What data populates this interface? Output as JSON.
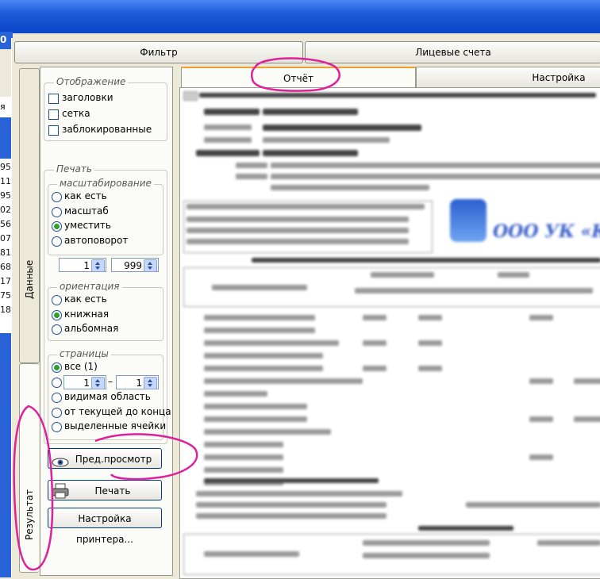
{
  "top_tabs": {
    "filter": "Фильтр",
    "accounts": "Лицевые счета"
  },
  "left_tabs": {
    "data": "Данные",
    "result": "Результат"
  },
  "display": {
    "title": "Отображение",
    "items": [
      "заголовки",
      "сетка",
      "заблокированные"
    ]
  },
  "print": {
    "title": "Печать",
    "scaling": {
      "title": "масштабирование",
      "options": [
        "как есть",
        "масштаб",
        "уместить",
        "автоповорот"
      ],
      "selected": "уместить",
      "spin_pages": "1",
      "spin_percent": "999"
    },
    "orientation": {
      "title": "ориентация",
      "options": [
        "как есть",
        "книжная",
        "альбомная"
      ],
      "selected": "книжная"
    },
    "pages": {
      "title": "страницы",
      "all_label": "все (1)",
      "from": "1",
      "to": "1",
      "options": [
        "видимая область",
        "от текущей до конца",
        "выделенные ячейки"
      ]
    }
  },
  "buttons": {
    "preview": "Пред.просмотр",
    "print": "Печать",
    "printer_setup": "Настройка принтера..."
  },
  "right_tabs": {
    "report": "Отчёт",
    "print_settings": "Настройка печатн"
  },
  "report": {
    "logo_text": "ООО УК «Ко"
  },
  "left_strip_numbers": [
    "95",
    "11",
    "95",
    "02",
    "56",
    "07",
    "81",
    "68",
    "17",
    "75",
    "18"
  ],
  "left_strip_top": [
    "0",
    "я"
  ]
}
